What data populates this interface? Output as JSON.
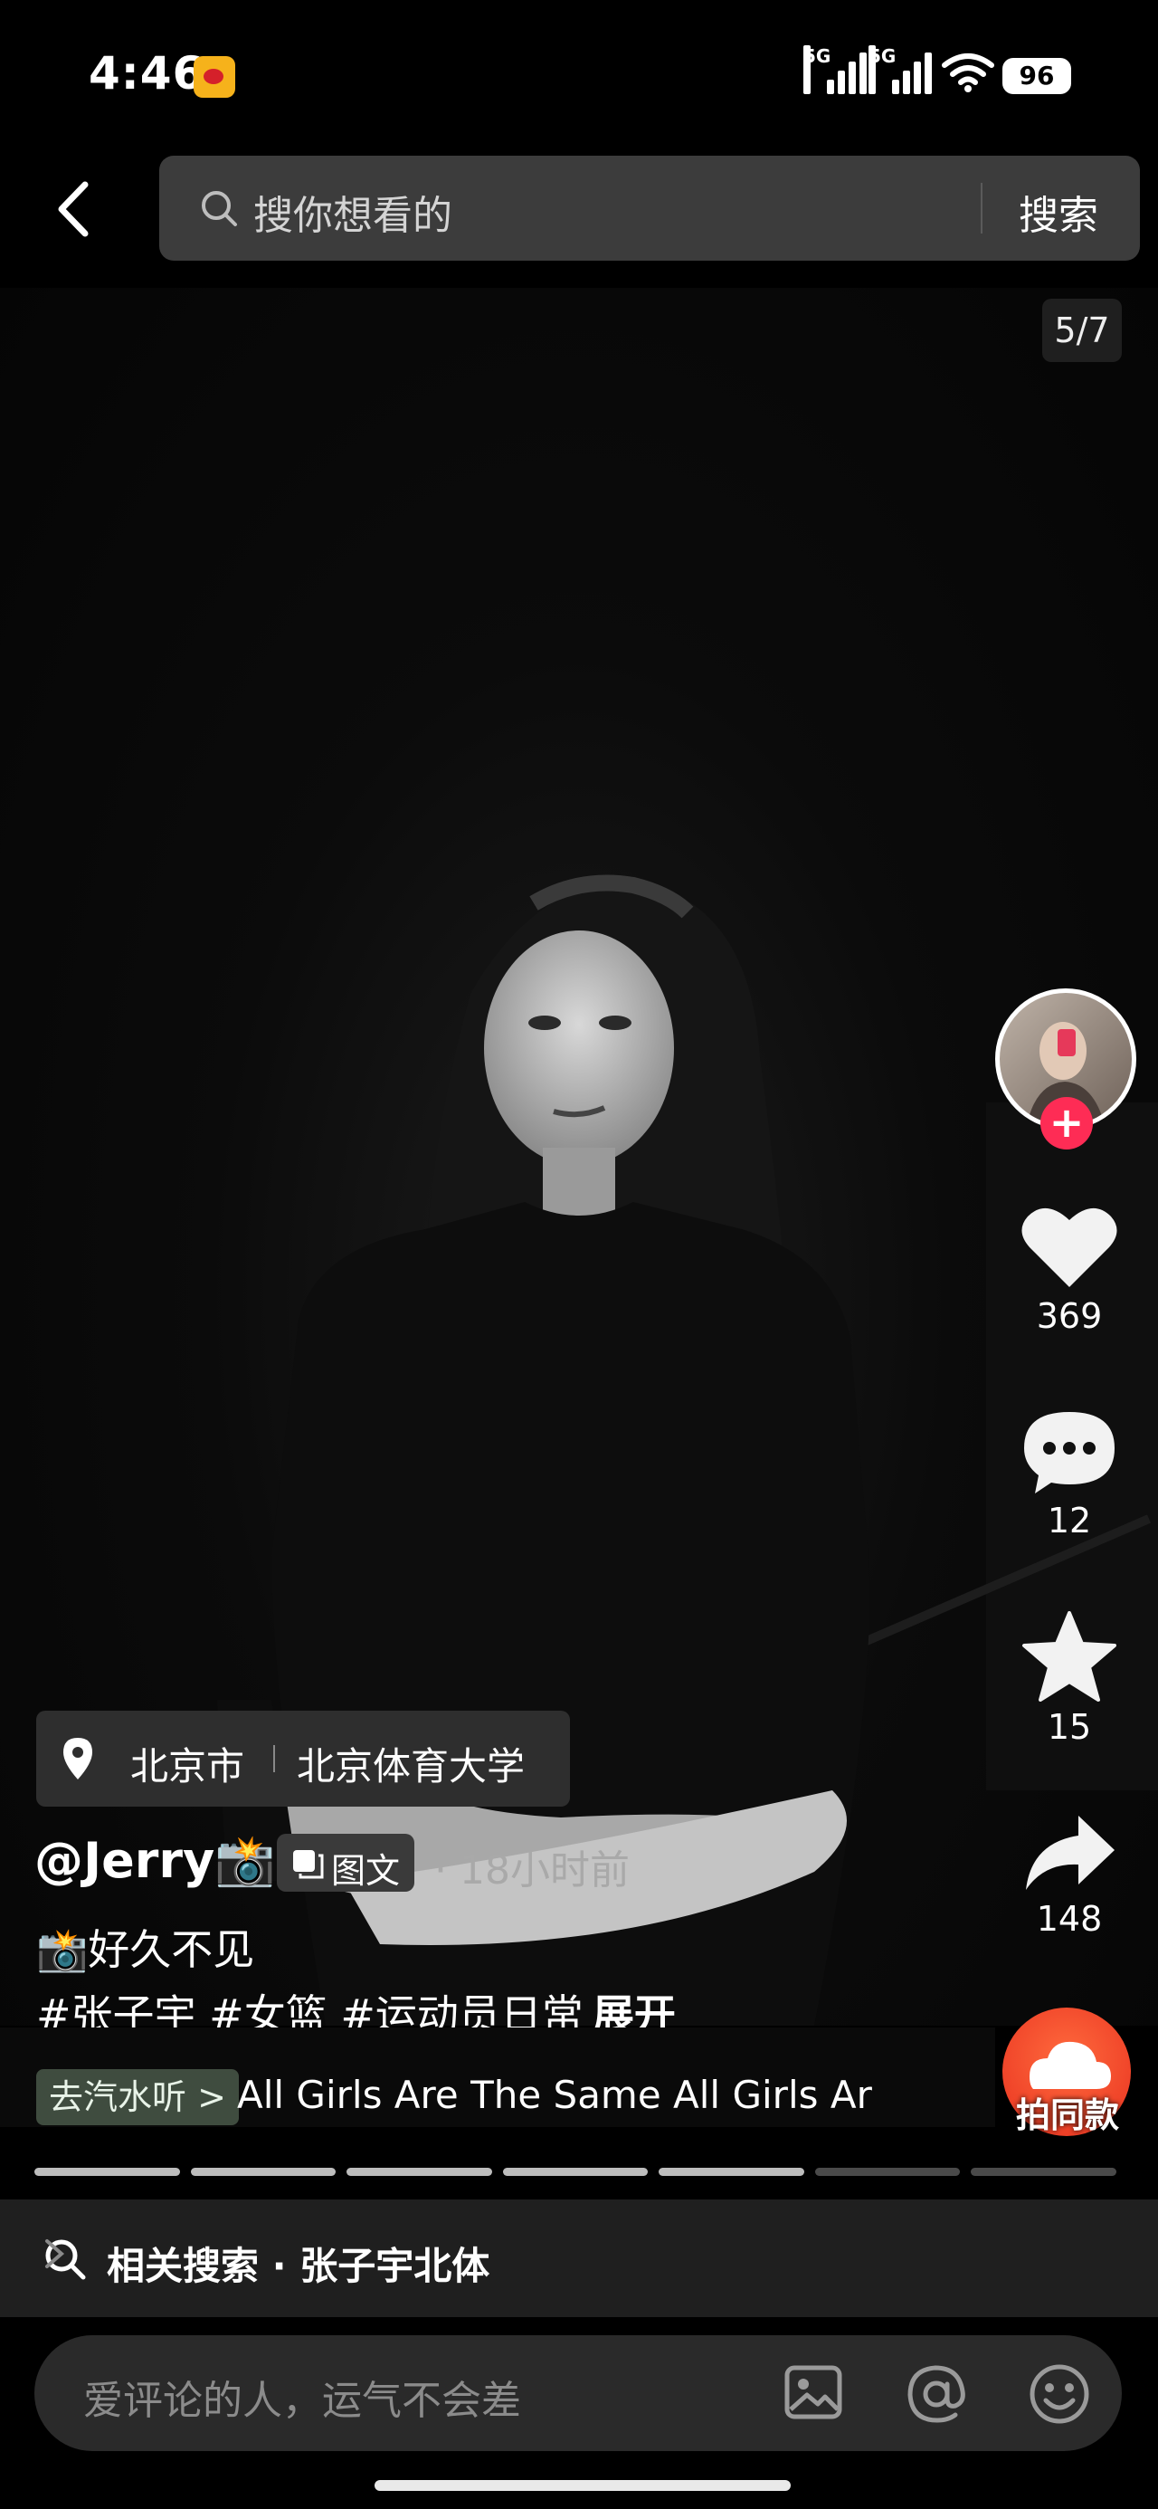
{
  "status_bar": {
    "time": "4:46",
    "network1": "5G",
    "network2": "5G",
    "battery": "96"
  },
  "search": {
    "placeholder": "搜你想看的",
    "button": "搜索"
  },
  "post": {
    "image_counter": "5/7",
    "location_city": "北京市",
    "location_place": "北京体育大学",
    "author": "@Jerry📸",
    "type_label": "图文",
    "time_ago": "· 18小时前",
    "caption_line1": "📸好久不见",
    "caption_tags": "#张子宇 #女篮 #运动员日常",
    "expand_label": "展开"
  },
  "actions": {
    "likes": "369",
    "comments": "12",
    "favorites": "15",
    "shares": "148"
  },
  "music": {
    "tag": "去汽水听 >",
    "title": "All Girls Are The Same    All Girls Ar",
    "use_same": "拍同款"
  },
  "progress": {
    "total": 7,
    "current": 5
  },
  "related": {
    "label": "相关搜索 · 张子宇北体"
  },
  "comment": {
    "placeholder": "爱评论的人，运气不会差"
  },
  "colors": {
    "accent_pink": "#fe2c55",
    "music_tag_bg": "#3f4c3f"
  }
}
